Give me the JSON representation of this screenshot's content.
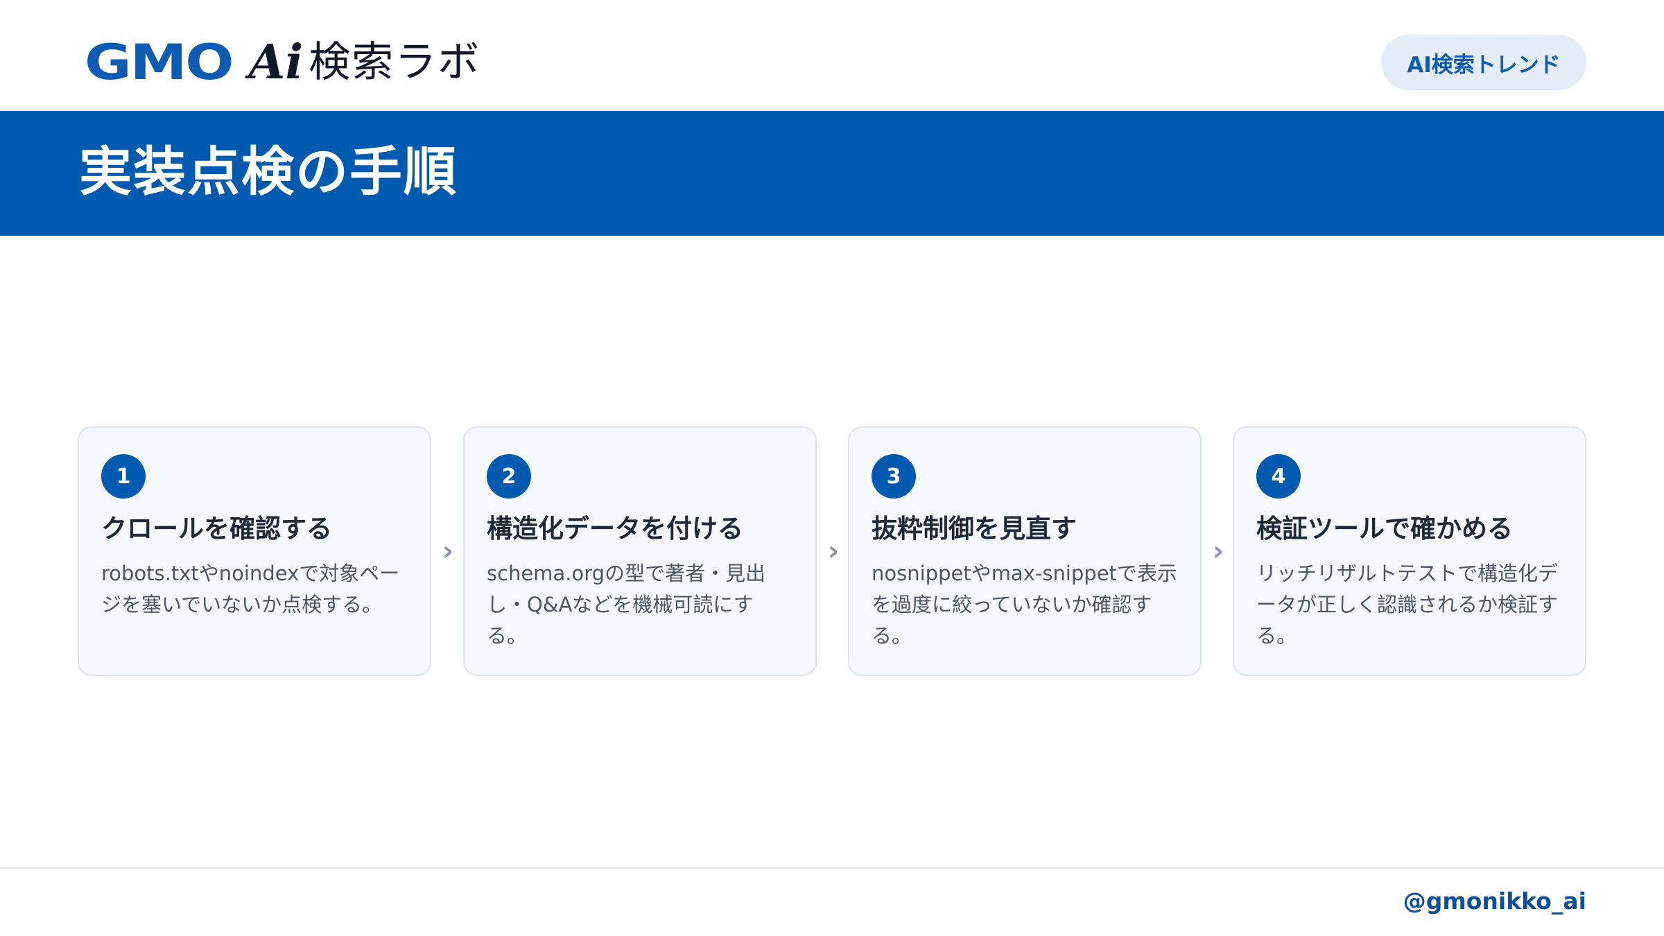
{
  "header": {
    "logo": {
      "brand": "GMO",
      "ai": "Ai",
      "lab": "検索ラボ"
    },
    "trend_button_label": "AI検索トレンド"
  },
  "title_band": {
    "title": "実装点検の手順"
  },
  "steps": [
    {
      "number": "1",
      "title": "クロールを確認する",
      "description": "robots.txtやnoindexで対象ページを塞いでいないか点検する。"
    },
    {
      "number": "2",
      "title": "構造化データを付ける",
      "description": "schema.orgの型で著者・見出し・Q&Aなどを機械可読にする。"
    },
    {
      "number": "3",
      "title": "抜粋制御を見直す",
      "description": "nosnippetやmax-snippetで表示を過度に絞っていないか確認する。"
    },
    {
      "number": "4",
      "title": "検証ツールで確かめる",
      "description": "リッチリザルトテストで構造化データが正しく認識されるか検証する。"
    }
  ],
  "arrow_glyph": "›",
  "footer": {
    "handle": "@gmonikko_ai"
  },
  "colors": {
    "brand_blue": "#005aaf",
    "pill_bg": "#e3ecf7",
    "card_bg": "#f6f8fc",
    "card_border": "#dde3ec"
  }
}
